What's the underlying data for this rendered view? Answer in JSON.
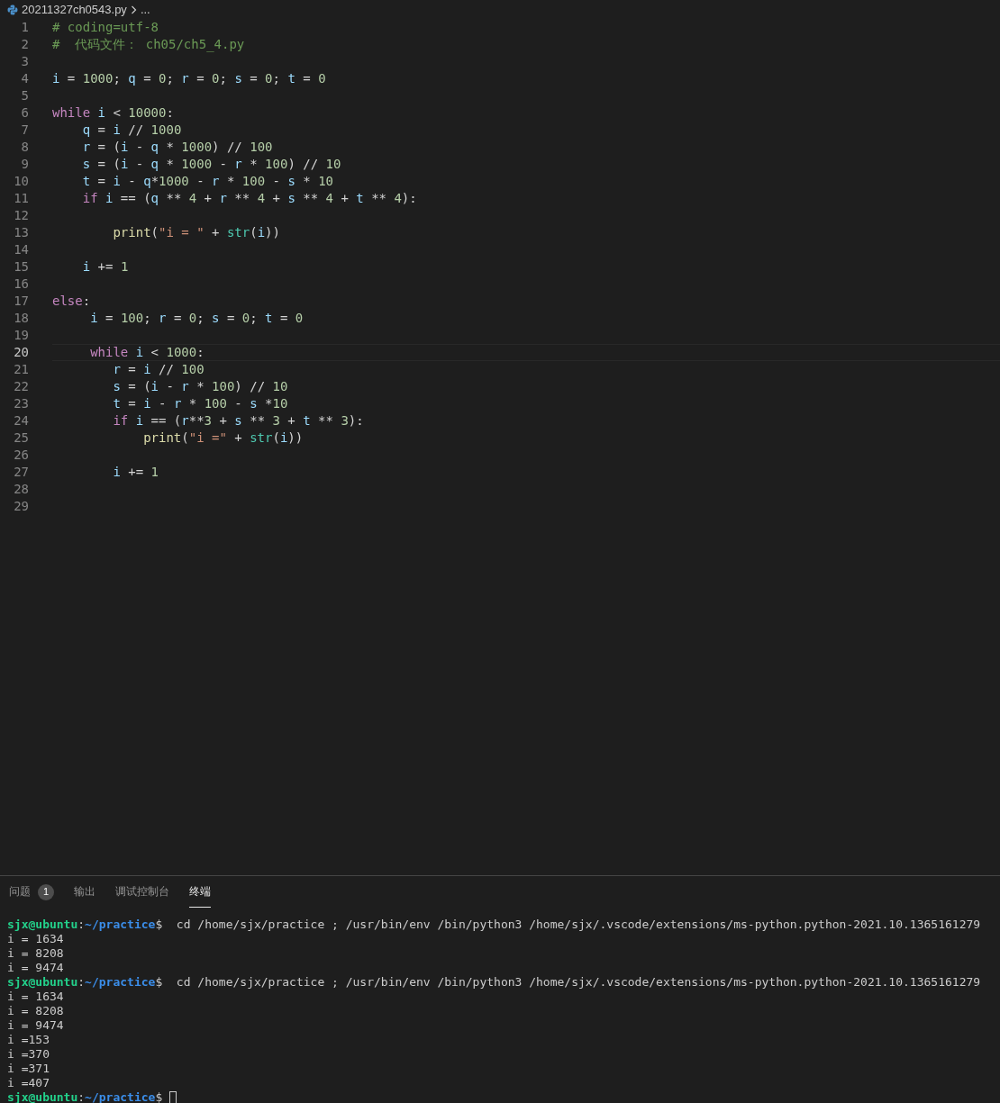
{
  "breadcrumb": {
    "file": "20211327ch0543.py",
    "more": "..."
  },
  "editor": {
    "lines": [
      {
        "number": "1",
        "current": false,
        "tokens": [
          {
            "kind": "comment",
            "text": "# coding=utf-8"
          }
        ]
      },
      {
        "number": "2",
        "current": false,
        "tokens": [
          {
            "kind": "comment",
            "text": "#  代码文件： ch05/ch5_4.py"
          }
        ]
      },
      {
        "number": "3",
        "current": false
      },
      {
        "number": "4",
        "current": false,
        "tokens": [
          {
            "kind": "name",
            "text": "i"
          },
          {
            "kind": "op",
            "text": " = "
          },
          {
            "kind": "number",
            "text": "1000"
          },
          {
            "kind": "op",
            "text": "; "
          },
          {
            "kind": "name",
            "text": "q"
          },
          {
            "kind": "op",
            "text": " = "
          },
          {
            "kind": "number",
            "text": "0"
          },
          {
            "kind": "op",
            "text": "; "
          },
          {
            "kind": "name",
            "text": "r"
          },
          {
            "kind": "op",
            "text": " = "
          },
          {
            "kind": "number",
            "text": "0"
          },
          {
            "kind": "op",
            "text": "; "
          },
          {
            "kind": "name",
            "text": "s"
          },
          {
            "kind": "op",
            "text": " = "
          },
          {
            "kind": "number",
            "text": "0"
          },
          {
            "kind": "op",
            "text": "; "
          },
          {
            "kind": "name",
            "text": "t"
          },
          {
            "kind": "op",
            "text": " = "
          },
          {
            "kind": "number",
            "text": "0"
          }
        ]
      },
      {
        "number": "5",
        "current": false
      },
      {
        "number": "6",
        "current": false,
        "tokens": [
          {
            "kind": "keyword",
            "text": "while"
          },
          {
            "kind": "name",
            "text": " i"
          },
          {
            "kind": "op",
            "text": " < "
          },
          {
            "kind": "number",
            "text": "10000"
          },
          {
            "kind": "op",
            "text": ":"
          }
        ]
      },
      {
        "number": "7",
        "current": false,
        "tokens": [
          {
            "kind": "name",
            "text": "    q"
          },
          {
            "kind": "op",
            "text": " = "
          },
          {
            "kind": "name",
            "text": "i"
          },
          {
            "kind": "op",
            "text": " // "
          },
          {
            "kind": "number",
            "text": "1000"
          }
        ]
      },
      {
        "number": "8",
        "current": false,
        "tokens": [
          {
            "kind": "name",
            "text": "    r"
          },
          {
            "kind": "op",
            "text": " = ("
          },
          {
            "kind": "name",
            "text": "i"
          },
          {
            "kind": "op",
            "text": " - "
          },
          {
            "kind": "name",
            "text": "q"
          },
          {
            "kind": "op",
            "text": " * "
          },
          {
            "kind": "number",
            "text": "1000"
          },
          {
            "kind": "op",
            "text": ") // "
          },
          {
            "kind": "number",
            "text": "100"
          }
        ]
      },
      {
        "number": "9",
        "current": false,
        "tokens": [
          {
            "kind": "name",
            "text": "    s"
          },
          {
            "kind": "op",
            "text": " = ("
          },
          {
            "kind": "name",
            "text": "i"
          },
          {
            "kind": "op",
            "text": " - "
          },
          {
            "kind": "name",
            "text": "q"
          },
          {
            "kind": "op",
            "text": " * "
          },
          {
            "kind": "number",
            "text": "1000"
          },
          {
            "kind": "op",
            "text": " - "
          },
          {
            "kind": "name",
            "text": "r"
          },
          {
            "kind": "op",
            "text": " * "
          },
          {
            "kind": "number",
            "text": "100"
          },
          {
            "kind": "op",
            "text": ") // "
          },
          {
            "kind": "number",
            "text": "10"
          }
        ]
      },
      {
        "number": "10",
        "current": false,
        "tokens": [
          {
            "kind": "name",
            "text": "    t"
          },
          {
            "kind": "op",
            "text": " = "
          },
          {
            "kind": "name",
            "text": "i"
          },
          {
            "kind": "op",
            "text": " - "
          },
          {
            "kind": "name",
            "text": "q"
          },
          {
            "kind": "op",
            "text": "*"
          },
          {
            "kind": "number",
            "text": "1000"
          },
          {
            "kind": "op",
            "text": " - "
          },
          {
            "kind": "name",
            "text": "r"
          },
          {
            "kind": "op",
            "text": " * "
          },
          {
            "kind": "number",
            "text": "100"
          },
          {
            "kind": "op",
            "text": " - "
          },
          {
            "kind": "name",
            "text": "s"
          },
          {
            "kind": "op",
            "text": " * "
          },
          {
            "kind": "number",
            "text": "10"
          }
        ]
      },
      {
        "number": "11",
        "current": false,
        "tokens": [
          {
            "kind": "keyword",
            "text": "    if"
          },
          {
            "kind": "name",
            "text": " i"
          },
          {
            "kind": "op",
            "text": " == ("
          },
          {
            "kind": "name",
            "text": "q"
          },
          {
            "kind": "op",
            "text": " ** "
          },
          {
            "kind": "number",
            "text": "4"
          },
          {
            "kind": "op",
            "text": " + "
          },
          {
            "kind": "name",
            "text": "r"
          },
          {
            "kind": "op",
            "text": " ** "
          },
          {
            "kind": "number",
            "text": "4"
          },
          {
            "kind": "op",
            "text": " + "
          },
          {
            "kind": "name",
            "text": "s"
          },
          {
            "kind": "op",
            "text": " ** "
          },
          {
            "kind": "number",
            "text": "4"
          },
          {
            "kind": "op",
            "text": " + "
          },
          {
            "kind": "name",
            "text": "t"
          },
          {
            "kind": "op",
            "text": " ** "
          },
          {
            "kind": "number",
            "text": "4"
          },
          {
            "kind": "op",
            "text": "):"
          }
        ]
      },
      {
        "number": "12",
        "current": false
      },
      {
        "number": "13",
        "current": false,
        "tokens": [
          {
            "kind": "function",
            "text": "        print"
          },
          {
            "kind": "op",
            "text": "("
          },
          {
            "kind": "string",
            "text": "\"i = \""
          },
          {
            "kind": "op",
            "text": " + "
          },
          {
            "kind": "builtin",
            "text": "str"
          },
          {
            "kind": "op",
            "text": "("
          },
          {
            "kind": "name",
            "text": "i"
          },
          {
            "kind": "op",
            "text": "))"
          }
        ]
      },
      {
        "number": "14",
        "current": false
      },
      {
        "number": "15",
        "current": false,
        "tokens": [
          {
            "kind": "name",
            "text": "    i"
          },
          {
            "kind": "op",
            "text": " += "
          },
          {
            "kind": "number",
            "text": "1"
          }
        ]
      },
      {
        "number": "16",
        "current": false
      },
      {
        "number": "17",
        "current": false,
        "tokens": [
          {
            "kind": "keyword",
            "text": "else"
          },
          {
            "kind": "op",
            "text": ":"
          }
        ]
      },
      {
        "number": "18",
        "current": false,
        "tokens": [
          {
            "kind": "name",
            "text": "     i"
          },
          {
            "kind": "op",
            "text": " = "
          },
          {
            "kind": "number",
            "text": "100"
          },
          {
            "kind": "op",
            "text": "; "
          },
          {
            "kind": "name",
            "text": "r"
          },
          {
            "kind": "op",
            "text": " = "
          },
          {
            "kind": "number",
            "text": "0"
          },
          {
            "kind": "op",
            "text": "; "
          },
          {
            "kind": "name",
            "text": "s"
          },
          {
            "kind": "op",
            "text": " = "
          },
          {
            "kind": "number",
            "text": "0"
          },
          {
            "kind": "op",
            "text": "; "
          },
          {
            "kind": "name",
            "text": "t"
          },
          {
            "kind": "op",
            "text": " = "
          },
          {
            "kind": "number",
            "text": "0"
          }
        ]
      },
      {
        "number": "19",
        "current": false
      },
      {
        "number": "20",
        "current": true,
        "tokens": [
          {
            "kind": "keyword",
            "text": "     while"
          },
          {
            "kind": "name",
            "text": " i"
          },
          {
            "kind": "op",
            "text": " < "
          },
          {
            "kind": "number",
            "text": "1000"
          },
          {
            "kind": "op",
            "text": ":"
          }
        ]
      },
      {
        "number": "21",
        "current": false,
        "tokens": [
          {
            "kind": "name",
            "text": "        r"
          },
          {
            "kind": "op",
            "text": " = "
          },
          {
            "kind": "name",
            "text": "i"
          },
          {
            "kind": "op",
            "text": " // "
          },
          {
            "kind": "number",
            "text": "100"
          }
        ]
      },
      {
        "number": "22",
        "current": false,
        "tokens": [
          {
            "kind": "name",
            "text": "        s"
          },
          {
            "kind": "op",
            "text": " = ("
          },
          {
            "kind": "name",
            "text": "i"
          },
          {
            "kind": "op",
            "text": " - "
          },
          {
            "kind": "name",
            "text": "r"
          },
          {
            "kind": "op",
            "text": " * "
          },
          {
            "kind": "number",
            "text": "100"
          },
          {
            "kind": "op",
            "text": ") // "
          },
          {
            "kind": "number",
            "text": "10"
          }
        ]
      },
      {
        "number": "23",
        "current": false,
        "tokens": [
          {
            "kind": "name",
            "text": "        t"
          },
          {
            "kind": "op",
            "text": " = "
          },
          {
            "kind": "name",
            "text": "i"
          },
          {
            "kind": "op",
            "text": " - "
          },
          {
            "kind": "name",
            "text": "r"
          },
          {
            "kind": "op",
            "text": " * "
          },
          {
            "kind": "number",
            "text": "100"
          },
          {
            "kind": "op",
            "text": " - "
          },
          {
            "kind": "name",
            "text": "s"
          },
          {
            "kind": "op",
            "text": " *"
          },
          {
            "kind": "number",
            "text": "10"
          }
        ]
      },
      {
        "number": "24",
        "current": false,
        "tokens": [
          {
            "kind": "keyword",
            "text": "        if"
          },
          {
            "kind": "name",
            "text": " i"
          },
          {
            "kind": "op",
            "text": " == ("
          },
          {
            "kind": "name",
            "text": "r"
          },
          {
            "kind": "op",
            "text": "**"
          },
          {
            "kind": "number",
            "text": "3"
          },
          {
            "kind": "op",
            "text": " + "
          },
          {
            "kind": "name",
            "text": "s"
          },
          {
            "kind": "op",
            "text": " ** "
          },
          {
            "kind": "number",
            "text": "3"
          },
          {
            "kind": "op",
            "text": " + "
          },
          {
            "kind": "name",
            "text": "t"
          },
          {
            "kind": "op",
            "text": " ** "
          },
          {
            "kind": "number",
            "text": "3"
          },
          {
            "kind": "op",
            "text": "):"
          }
        ]
      },
      {
        "number": "25",
        "current": false,
        "tokens": [
          {
            "kind": "function",
            "text": "            print"
          },
          {
            "kind": "op",
            "text": "("
          },
          {
            "kind": "string",
            "text": "\"i =\""
          },
          {
            "kind": "op",
            "text": " + "
          },
          {
            "kind": "builtin",
            "text": "str"
          },
          {
            "kind": "op",
            "text": "("
          },
          {
            "kind": "name",
            "text": "i"
          },
          {
            "kind": "op",
            "text": "))"
          }
        ]
      },
      {
        "number": "26",
        "current": false
      },
      {
        "number": "27",
        "current": false,
        "tokens": [
          {
            "kind": "name",
            "text": "        i"
          },
          {
            "kind": "op",
            "text": " += "
          },
          {
            "kind": "number",
            "text": "1"
          }
        ]
      },
      {
        "number": "28",
        "current": false
      },
      {
        "number": "29",
        "current": false
      }
    ]
  },
  "panel": {
    "tabs": [
      {
        "label": "问题",
        "badge": "1",
        "selected": false
      },
      {
        "label": "输出",
        "selected": false
      },
      {
        "label": "调试控制台",
        "selected": false
      },
      {
        "label": "终端",
        "selected": true
      }
    ],
    "terminal": [
      {
        "kind": "prompt",
        "user": "sjx@ubuntu",
        "sep": ":",
        "path": "~/practice",
        "dollar": "$",
        "command": "  cd /home/sjx/practice ; /usr/bin/env /bin/python3 /home/sjx/.vscode/extensions/ms-python.python-2021.10.1365161279",
        "cursor": false
      },
      {
        "kind": "output",
        "text": "i = 1634"
      },
      {
        "kind": "output",
        "text": "i = 8208"
      },
      {
        "kind": "output",
        "text": "i = 9474"
      },
      {
        "kind": "prompt",
        "user": "sjx@ubuntu",
        "sep": ":",
        "path": "~/practice",
        "dollar": "$",
        "command": "  cd /home/sjx/practice ; /usr/bin/env /bin/python3 /home/sjx/.vscode/extensions/ms-python.python-2021.10.1365161279",
        "cursor": false
      },
      {
        "kind": "output",
        "text": "i = 1634"
      },
      {
        "kind": "output",
        "text": "i = 8208"
      },
      {
        "kind": "output",
        "text": "i = 9474"
      },
      {
        "kind": "output",
        "text": "i =153"
      },
      {
        "kind": "output",
        "text": "i =370"
      },
      {
        "kind": "output",
        "text": "i =371"
      },
      {
        "kind": "output",
        "text": "i =407"
      },
      {
        "kind": "prompt",
        "user": "sjx@ubuntu",
        "sep": ":",
        "path": "~/practice",
        "dollar": "$",
        "cursor": true
      }
    ]
  }
}
